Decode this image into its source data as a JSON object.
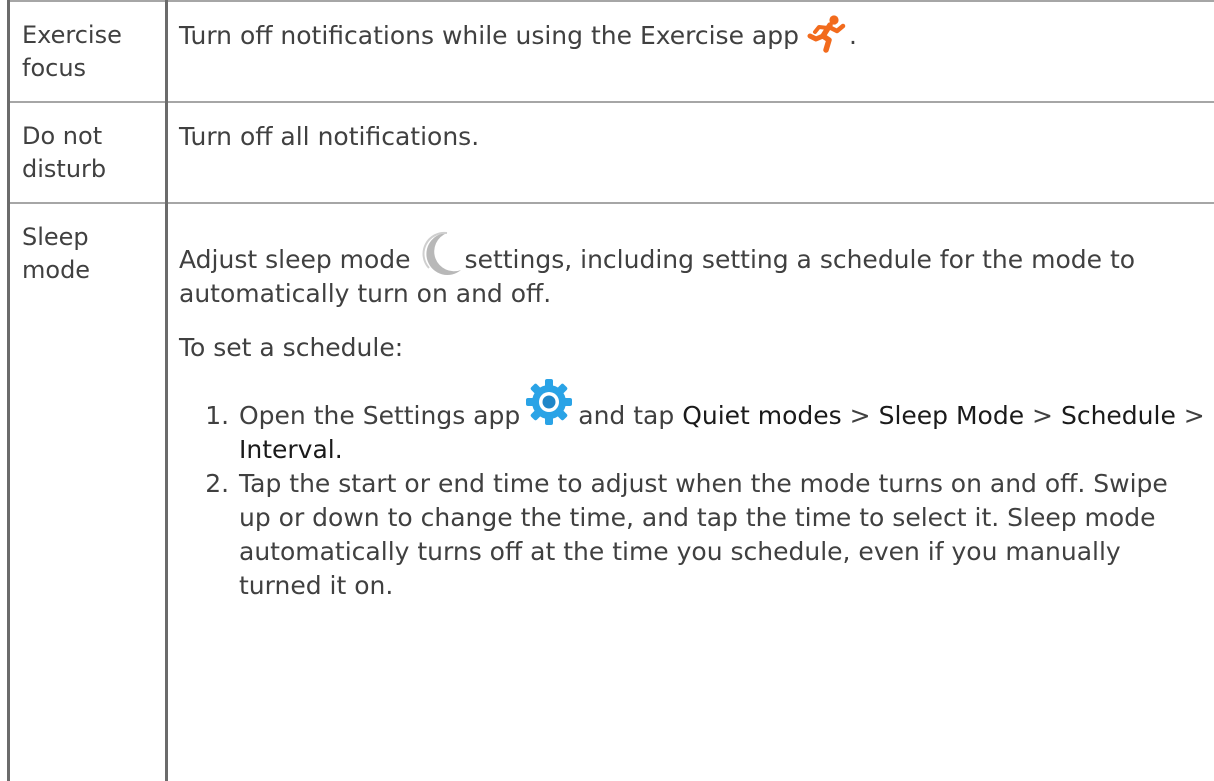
{
  "rows": [
    {
      "term": "Exercise focus",
      "description": {
        "text": "Turn off notifications while using the Exercise app",
        "suffix": ".",
        "icon": "running-figure-icon"
      }
    },
    {
      "term": "Do not disturb",
      "description": {
        "text": "Turn off all notifications."
      }
    },
    {
      "term": "Sleep mode",
      "description": {
        "intro_before_icon": "Adjust sleep mode",
        "intro_icon": "moon-icon",
        "intro_after_icon": "settings, including setting a schedule for the mode to automatically turn on and off.",
        "schedule_lead": "To set a schedule:",
        "steps": [
          {
            "before_icon": "Open the Settings app",
            "icon": "settings-gear-icon",
            "after_icon": "and tap",
            "path": [
              "Quiet modes",
              "Sleep Mode",
              "Schedule",
              "Interval."
            ],
            "separator": ">"
          },
          {
            "text": "Tap the start or end time to adjust when the mode turns on and off. Swipe up or down to change the time, and tap the time to select it. Sleep mode automatically turns off at the time you schedule, even if you manually turned it on."
          }
        ]
      }
    }
  ],
  "colors": {
    "text": "#404040",
    "ui_term": "#1a1a1a",
    "run_icon": "#f26b1d",
    "moon_icon": "#b8b8b8",
    "gear_icon": "#2aa3e6"
  }
}
